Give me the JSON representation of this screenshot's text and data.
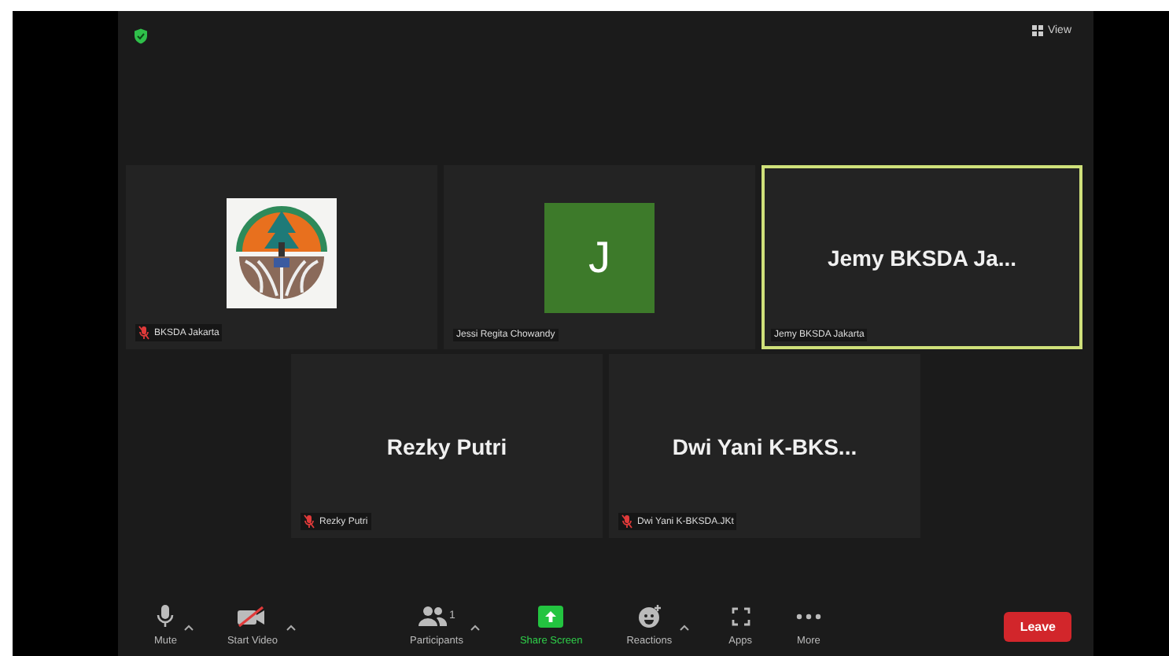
{
  "top_bar": {
    "secure": true,
    "view_label": "View"
  },
  "tiles": [
    {
      "kind": "logo",
      "label": "BKSDA Jakarta",
      "muted": true,
      "active_speaker": false
    },
    {
      "kind": "letter",
      "letter": "J",
      "label": "Jessi Regita Chowandy",
      "muted": false,
      "active_speaker": false
    },
    {
      "kind": "name",
      "display_name": "Jemy BKSDA Ja...",
      "label": "Jemy BKSDA Jakarta",
      "muted": false,
      "active_speaker": true
    },
    {
      "kind": "name",
      "display_name": "Rezky Putri",
      "label": "Rezky Putri",
      "muted": true,
      "active_speaker": false
    },
    {
      "kind": "name",
      "display_name": "Dwi Yani K-BKS...",
      "label": "Dwi Yani K-BKSDA.JKt",
      "muted": true,
      "active_speaker": false
    }
  ],
  "toolbar": [
    {
      "kind": "mic",
      "label": "Mute",
      "caret": true
    },
    {
      "kind": "video-off",
      "label": "Start Video",
      "caret": true
    },
    {
      "kind": "participants",
      "label": "Participants",
      "count": "1",
      "caret": true
    },
    {
      "kind": "share",
      "label": "Share Screen",
      "caret": false
    },
    {
      "kind": "reactions",
      "label": "Reactions",
      "caret": true
    },
    {
      "kind": "apps",
      "label": "Apps",
      "caret": false
    },
    {
      "kind": "more",
      "label": "More",
      "caret": false
    },
    {
      "kind": "leave",
      "label": "Leave",
      "caret": false
    }
  ]
}
